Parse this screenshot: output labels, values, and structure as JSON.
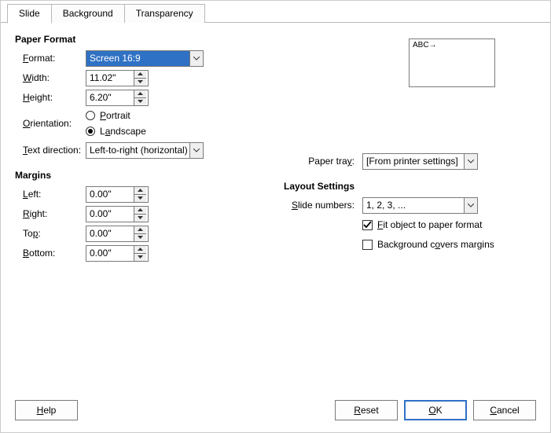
{
  "tabs": {
    "slide": "Slide",
    "background": "Background",
    "transparency": "Transparency"
  },
  "paper_format": {
    "title": "Paper Format",
    "format_label": "Format:",
    "format_value": "Screen 16:9",
    "width_label": "Width:",
    "width_value": "11.02\"",
    "height_label": "Height:",
    "height_value": "6.20\"",
    "orientation_label": "Orientation:",
    "portrait": "Portrait",
    "landscape": "Landscape",
    "text_dir_label": "Text direction:",
    "text_dir_value": "Left-to-right (horizontal)",
    "paper_tray_label": "Paper tray:",
    "paper_tray_value": "[From printer settings]",
    "preview_text": "ABC→"
  },
  "margins": {
    "title": "Margins",
    "left_label": "Left:",
    "left_value": "0.00\"",
    "right_label": "Right:",
    "right_value": "0.00\"",
    "top_label": "Top:",
    "top_value": "0.00\"",
    "bottom_label": "Bottom:",
    "bottom_value": "0.00\""
  },
  "layout": {
    "title": "Layout Settings",
    "slide_numbers_label": "Slide numbers:",
    "slide_numbers_value": "1, 2, 3, ...",
    "fit_object": "Fit object to paper format",
    "bg_covers": "Background covers margins"
  },
  "buttons": {
    "help": "Help",
    "reset": "Reset",
    "ok": "OK",
    "cancel": "Cancel"
  }
}
